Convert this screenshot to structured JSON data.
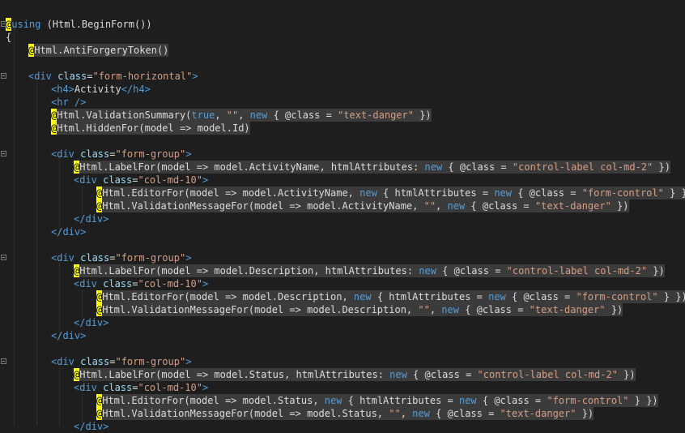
{
  "lines": [
    {
      "indent": 0,
      "parts": [
        {
          "t": "at",
          "v": "@"
        },
        {
          "t": "kw",
          "v": "using"
        },
        {
          "t": "code",
          "v": " (Html.BeginForm())"
        }
      ]
    },
    {
      "indent": 0,
      "parts": [
        {
          "t": "code",
          "v": "{"
        }
      ]
    },
    {
      "indent": 4,
      "parts": [
        {
          "t": "at",
          "v": "@"
        },
        {
          "t": "code",
          "v": "Html.AntiForgeryToken()",
          "razor": true
        }
      ]
    },
    {
      "indent": 0,
      "parts": []
    },
    {
      "indent": 4,
      "parts": [
        {
          "t": "tag",
          "v": "<div "
        },
        {
          "t": "attr",
          "v": "class"
        },
        {
          "t": "txt",
          "v": "="
        },
        {
          "t": "str",
          "v": "\"form-horizontal\""
        },
        {
          "t": "tag",
          "v": ">"
        }
      ]
    },
    {
      "indent": 8,
      "parts": [
        {
          "t": "tag",
          "v": "<h4>"
        },
        {
          "t": "txt",
          "v": "Activity"
        },
        {
          "t": "tag",
          "v": "</h4>"
        }
      ]
    },
    {
      "indent": 8,
      "parts": [
        {
          "t": "tag",
          "v": "<hr />"
        }
      ]
    },
    {
      "indent": 8,
      "razor": true,
      "parts": [
        {
          "t": "at",
          "v": "@"
        },
        {
          "t": "code",
          "v": "Html.ValidationSummary("
        },
        {
          "t": "kw",
          "v": "true"
        },
        {
          "t": "code",
          "v": ", "
        },
        {
          "t": "str",
          "v": "\"\""
        },
        {
          "t": "code",
          "v": ", "
        },
        {
          "t": "kw",
          "v": "new"
        },
        {
          "t": "code",
          "v": " { @class = "
        },
        {
          "t": "str",
          "v": "\"text-danger\""
        },
        {
          "t": "code",
          "v": " })"
        }
      ]
    },
    {
      "indent": 8,
      "razor": true,
      "parts": [
        {
          "t": "at",
          "v": "@"
        },
        {
          "t": "code",
          "v": "Html.HiddenFor(model => model.Id)"
        }
      ]
    },
    {
      "indent": 0,
      "parts": []
    },
    {
      "indent": 8,
      "parts": [
        {
          "t": "tag",
          "v": "<div "
        },
        {
          "t": "attr",
          "v": "class"
        },
        {
          "t": "txt",
          "v": "="
        },
        {
          "t": "str",
          "v": "\"form-group\""
        },
        {
          "t": "tag",
          "v": ">"
        }
      ]
    },
    {
      "indent": 12,
      "razor": true,
      "parts": [
        {
          "t": "at",
          "v": "@"
        },
        {
          "t": "code",
          "v": "Html.LabelFor(model => model.ActivityName, htmlAttributes: "
        },
        {
          "t": "kw",
          "v": "new"
        },
        {
          "t": "code",
          "v": " { @class = "
        },
        {
          "t": "str",
          "v": "\"control-label col-md-2\""
        },
        {
          "t": "code",
          "v": " })"
        }
      ]
    },
    {
      "indent": 12,
      "parts": [
        {
          "t": "tag",
          "v": "<div "
        },
        {
          "t": "attr",
          "v": "class"
        },
        {
          "t": "txt",
          "v": "="
        },
        {
          "t": "str",
          "v": "\"col-md-10\""
        },
        {
          "t": "tag",
          "v": ">"
        }
      ]
    },
    {
      "indent": 16,
      "razor": true,
      "parts": [
        {
          "t": "at",
          "v": "@"
        },
        {
          "t": "code",
          "v": "Html.EditorFor(model => model.ActivityName, "
        },
        {
          "t": "kw",
          "v": "new"
        },
        {
          "t": "code",
          "v": " { htmlAttributes = "
        },
        {
          "t": "kw",
          "v": "new"
        },
        {
          "t": "code",
          "v": " { @class = "
        },
        {
          "t": "str",
          "v": "\"form-control\""
        },
        {
          "t": "code",
          "v": " } })"
        }
      ]
    },
    {
      "indent": 16,
      "razor": true,
      "parts": [
        {
          "t": "at",
          "v": "@"
        },
        {
          "t": "code",
          "v": "Html.ValidationMessageFor(model => model.ActivityName, "
        },
        {
          "t": "str",
          "v": "\"\""
        },
        {
          "t": "code",
          "v": ", "
        },
        {
          "t": "kw",
          "v": "new"
        },
        {
          "t": "code",
          "v": " { @class = "
        },
        {
          "t": "str",
          "v": "\"text-danger\""
        },
        {
          "t": "code",
          "v": " })"
        }
      ]
    },
    {
      "indent": 12,
      "parts": [
        {
          "t": "tag",
          "v": "</div>"
        }
      ]
    },
    {
      "indent": 8,
      "parts": [
        {
          "t": "tag",
          "v": "</div>"
        }
      ]
    },
    {
      "indent": 0,
      "parts": []
    },
    {
      "indent": 8,
      "parts": [
        {
          "t": "tag",
          "v": "<div "
        },
        {
          "t": "attr",
          "v": "class"
        },
        {
          "t": "txt",
          "v": "="
        },
        {
          "t": "str",
          "v": "\"form-group\""
        },
        {
          "t": "tag",
          "v": ">"
        }
      ]
    },
    {
      "indent": 12,
      "razor": true,
      "parts": [
        {
          "t": "at",
          "v": "@"
        },
        {
          "t": "code",
          "v": "Html.LabelFor(model => model.Description, htmlAttributes: "
        },
        {
          "t": "kw",
          "v": "new"
        },
        {
          "t": "code",
          "v": " { @class = "
        },
        {
          "t": "str",
          "v": "\"control-label col-md-2\""
        },
        {
          "t": "code",
          "v": " })"
        }
      ]
    },
    {
      "indent": 12,
      "parts": [
        {
          "t": "tag",
          "v": "<div "
        },
        {
          "t": "attr",
          "v": "class"
        },
        {
          "t": "txt",
          "v": "="
        },
        {
          "t": "str",
          "v": "\"col-md-10\""
        },
        {
          "t": "tag",
          "v": ">"
        }
      ]
    },
    {
      "indent": 16,
      "razor": true,
      "parts": [
        {
          "t": "at",
          "v": "@"
        },
        {
          "t": "code",
          "v": "Html.EditorFor(model => model.Description, "
        },
        {
          "t": "kw",
          "v": "new"
        },
        {
          "t": "code",
          "v": " { htmlAttributes = "
        },
        {
          "t": "kw",
          "v": "new"
        },
        {
          "t": "code",
          "v": " { @class = "
        },
        {
          "t": "str",
          "v": "\"form-control\""
        },
        {
          "t": "code",
          "v": " } })"
        }
      ]
    },
    {
      "indent": 16,
      "razor": true,
      "parts": [
        {
          "t": "at",
          "v": "@"
        },
        {
          "t": "code",
          "v": "Html.ValidationMessageFor(model => model.Description, "
        },
        {
          "t": "str",
          "v": "\"\""
        },
        {
          "t": "code",
          "v": ", "
        },
        {
          "t": "kw",
          "v": "new"
        },
        {
          "t": "code",
          "v": " { @class = "
        },
        {
          "t": "str",
          "v": "\"text-danger\""
        },
        {
          "t": "code",
          "v": " })"
        }
      ]
    },
    {
      "indent": 12,
      "parts": [
        {
          "t": "tag",
          "v": "</div>"
        }
      ]
    },
    {
      "indent": 8,
      "parts": [
        {
          "t": "tag",
          "v": "</div>"
        }
      ]
    },
    {
      "indent": 0,
      "parts": []
    },
    {
      "indent": 8,
      "parts": [
        {
          "t": "tag",
          "v": "<div "
        },
        {
          "t": "attr",
          "v": "class"
        },
        {
          "t": "txt",
          "v": "="
        },
        {
          "t": "str",
          "v": "\"form-group\""
        },
        {
          "t": "tag",
          "v": ">"
        }
      ]
    },
    {
      "indent": 12,
      "razor": true,
      "parts": [
        {
          "t": "at",
          "v": "@"
        },
        {
          "t": "code",
          "v": "Html.LabelFor(model => model.Status, htmlAttributes: "
        },
        {
          "t": "kw",
          "v": "new"
        },
        {
          "t": "code",
          "v": " { @class = "
        },
        {
          "t": "str",
          "v": "\"control-label col-md-2\""
        },
        {
          "t": "code",
          "v": " })"
        }
      ]
    },
    {
      "indent": 12,
      "parts": [
        {
          "t": "tag",
          "v": "<div "
        },
        {
          "t": "attr",
          "v": "class"
        },
        {
          "t": "txt",
          "v": "="
        },
        {
          "t": "str",
          "v": "\"col-md-10\""
        },
        {
          "t": "tag",
          "v": ">"
        }
      ]
    },
    {
      "indent": 16,
      "razor": true,
      "parts": [
        {
          "t": "at",
          "v": "@"
        },
        {
          "t": "code",
          "v": "Html.EditorFor(model => model.Status, "
        },
        {
          "t": "kw",
          "v": "new"
        },
        {
          "t": "code",
          "v": " { htmlAttributes = "
        },
        {
          "t": "kw",
          "v": "new"
        },
        {
          "t": "code",
          "v": " { @class = "
        },
        {
          "t": "str",
          "v": "\"form-control\""
        },
        {
          "t": "code",
          "v": " } })"
        }
      ]
    },
    {
      "indent": 16,
      "razor": true,
      "parts": [
        {
          "t": "at",
          "v": "@"
        },
        {
          "t": "code",
          "v": "Html.ValidationMessageFor(model => model.Status, "
        },
        {
          "t": "str",
          "v": "\"\""
        },
        {
          "t": "code",
          "v": ", "
        },
        {
          "t": "kw",
          "v": "new"
        },
        {
          "t": "code",
          "v": " { @class = "
        },
        {
          "t": "str",
          "v": "\"text-danger\""
        },
        {
          "t": "code",
          "v": " })"
        }
      ]
    },
    {
      "indent": 12,
      "parts": [
        {
          "t": "tag",
          "v": "</div>"
        }
      ]
    }
  ],
  "folds": [
    0,
    4,
    10,
    18,
    26
  ]
}
